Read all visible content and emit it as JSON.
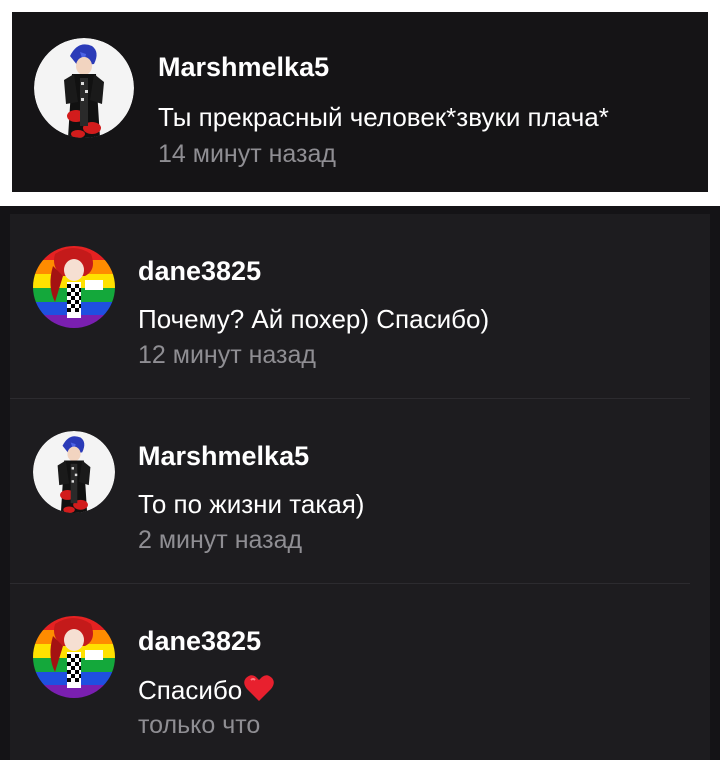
{
  "highlighted": {
    "username": "Marshmelka5",
    "message": "Ты прекрасный человек*звуки плача*",
    "time": "14 минут назад",
    "avatar_icon": "anime-character-avatar-blue-hair"
  },
  "comments": [
    {
      "username": "dane3825",
      "message": "Почему? Ай похер) Спасибо)",
      "time": "12 минут назад",
      "avatar_icon": "rainbow-avatar-red-hair"
    },
    {
      "username": "Marshmelka5",
      "message": "То по жизни такая)",
      "time": "2 минут назад",
      "avatar_icon": "anime-character-avatar-blue-hair"
    },
    {
      "username": "dane3825",
      "message": "Спасибо",
      "time": "только что",
      "avatar_icon": "rainbow-avatar-red-hair",
      "emoji": "heart-emoji"
    }
  ],
  "colors": {
    "background": "#1d1c1f",
    "username": "#ffffff",
    "timestamp": "#8f8e93",
    "heart": "#e8202e"
  }
}
